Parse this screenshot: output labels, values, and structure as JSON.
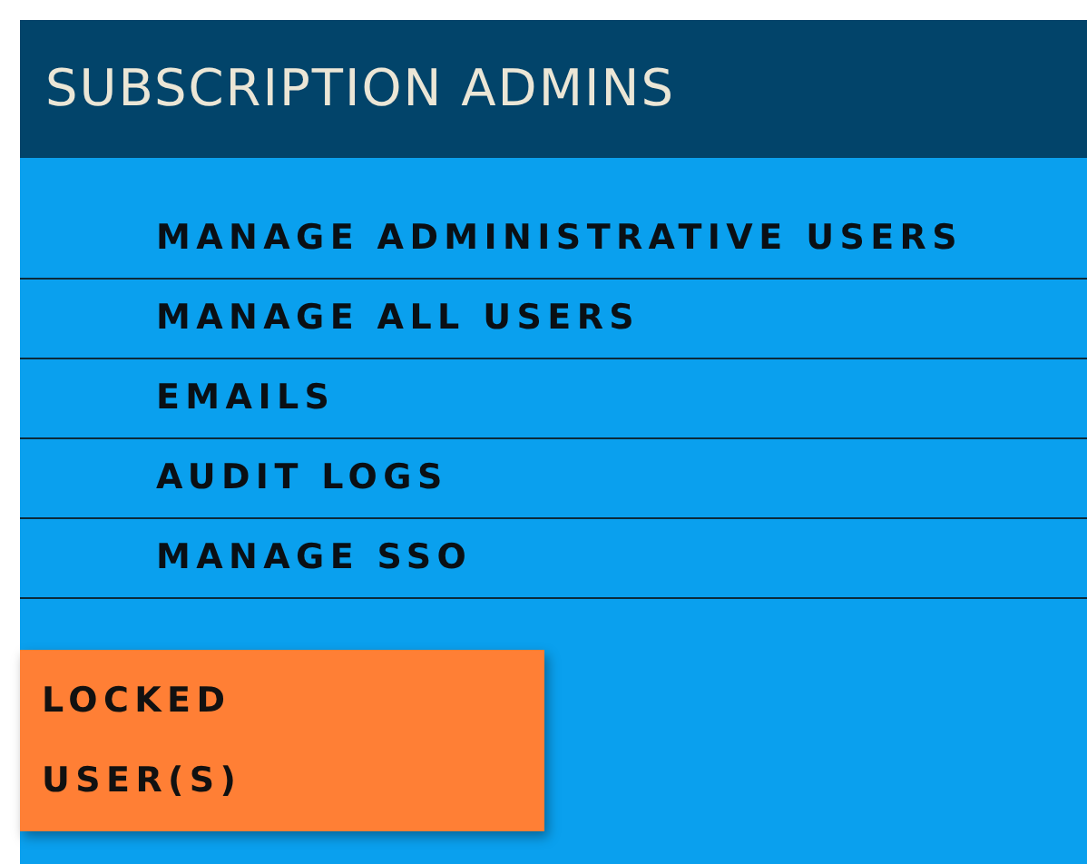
{
  "panel": {
    "title": "SUBSCRIPTION ADMINS"
  },
  "menu": [
    {
      "label": "MANAGE ADMINISTRATIVE USERS"
    },
    {
      "label": "MANAGE ALL USERS"
    },
    {
      "label": "EMAILS"
    },
    {
      "label": "AUDIT LOGS"
    },
    {
      "label": "MANAGE SSO"
    }
  ],
  "alert_button": {
    "label": "LOCKED USER(S)"
  }
}
